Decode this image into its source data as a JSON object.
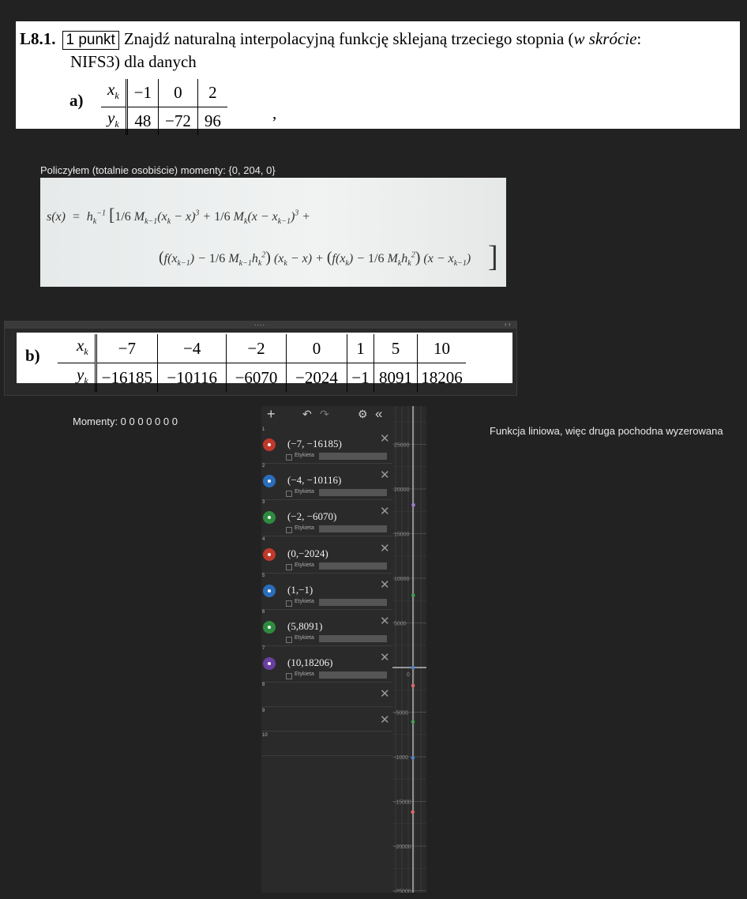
{
  "task": {
    "number": "L8.1.",
    "points": "1 punkt",
    "line1_before": "Znajdź naturalną interpolacyjną funkcję sklejaną trzeciego stopnia (",
    "line1_italic": "w skrócie",
    "line1_after": ":",
    "line2": "NIFS3) dla danych",
    "part_a": "a)",
    "xk": "x_k",
    "yk": "y_k",
    "a_x": [
      "−1",
      "0",
      "2"
    ],
    "a_y": [
      "48",
      "−72",
      "96"
    ],
    "comma": ","
  },
  "note_moments_a": "Policzyłem (totalnie osobiście) momenty: {0, 204, 0}",
  "formula": {
    "line1": "s(x) = h_k^{-1} [ 1/6 M_{k−1}(x_k − x)^3 + 1/6 M_k(x − x_{k−1})^3 +",
    "line2": "( f(x_{k−1}) − 1/6 M_{k−1}h_k^2 ) (x_k − x) + ( f(x_k) − 1/6 M_k h_k^2 ) (x − x_{k−1})"
  },
  "part_b": {
    "label": "b)",
    "x": [
      "−7",
      "−4",
      "−2",
      "0",
      "1",
      "5",
      "10"
    ],
    "y": [
      "−16185",
      "−10116",
      "−6070",
      "−2024",
      "−1",
      "8091",
      "18206"
    ],
    "dots": "....",
    "arrows": "‹ ›"
  },
  "note_moments_b": "Momenty: 0 0 0 0 0 0 0",
  "note_linear": "Funkcja liniowa, więc druga pochodna wyzerowana",
  "algebra": {
    "toolbar": {
      "add": "+",
      "undo": "↶",
      "redo": "↷",
      "settings": "⚙",
      "collapse": "«"
    },
    "label_text": "Etykieta",
    "close": "✕",
    "rows": [
      {
        "index": "1",
        "expr": "(−7, −16185)",
        "color": "#c0392b"
      },
      {
        "index": "2",
        "expr": "(−4, −10116)",
        "color": "#2a6ebb"
      },
      {
        "index": "3",
        "expr": "(−2, −6070)",
        "color": "#2e8b3e"
      },
      {
        "index": "4",
        "expr": "(0,−2024)",
        "color": "#c0392b"
      },
      {
        "index": "5",
        "expr": "(1,−1)",
        "color": "#2a6ebb"
      },
      {
        "index": "6",
        "expr": "(5,8091)",
        "color": "#2e8b3e"
      },
      {
        "index": "7",
        "expr": "(10,18206)",
        "color": "#6a3fa0"
      },
      {
        "index": "8",
        "expr": "",
        "color": ""
      },
      {
        "index": "9",
        "expr": "",
        "color": ""
      },
      {
        "index": "10",
        "expr": "",
        "color": ""
      }
    ]
  },
  "graph": {
    "y_ticks": [
      "25000",
      "20000",
      "15000",
      "10000",
      "5000",
      "0",
      "-5000",
      "-1000",
      "-15000",
      "-20000",
      "-25000"
    ],
    "points": [
      {
        "x": -7,
        "y": -16185,
        "color": "#e06666"
      },
      {
        "x": -4,
        "y": -10116,
        "color": "#4a86c8"
      },
      {
        "x": -2,
        "y": -6070,
        "color": "#3fa34d"
      },
      {
        "x": 0,
        "y": -2024,
        "color": "#e06666"
      },
      {
        "x": 1,
        "y": -1,
        "color": "#4a86c8"
      },
      {
        "x": 5,
        "y": 8091,
        "color": "#3fa34d"
      },
      {
        "x": 10,
        "y": 18206,
        "color": "#9a7fd4"
      }
    ]
  }
}
